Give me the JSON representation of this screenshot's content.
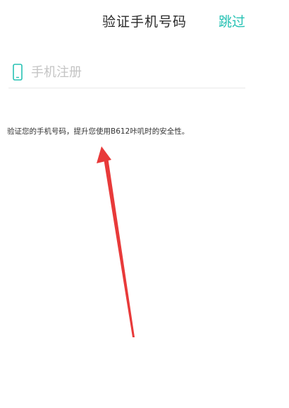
{
  "header": {
    "title": "验证手机号码",
    "skip_label": "跳过"
  },
  "phone": {
    "placeholder": "手机注册",
    "value": ""
  },
  "description": "验证您的手机号码，提升您使用B612咔叽时的安全性。",
  "colors": {
    "accent": "#27c2b4",
    "arrow": "#e83a3a"
  },
  "icons": {
    "phone": "smartphone-icon"
  }
}
